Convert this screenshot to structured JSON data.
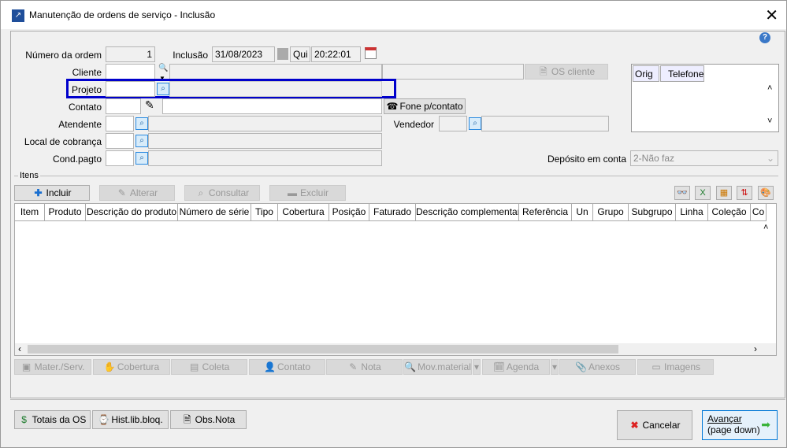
{
  "window": {
    "title": "Manutenção de ordens de serviço - Inclusão",
    "close": "✕"
  },
  "header": {
    "numero_label": "Número da ordem",
    "numero_value": "1",
    "inclusao_label": "Inclusão",
    "inclusao_date": "31/08/2023",
    "inclusao_day": "Qui",
    "inclusao_time": "20:22:01",
    "cliente_label": "Cliente",
    "projeto_label": "Projeto",
    "contato_label": "Contato",
    "atendente_label": "Atendente",
    "local_label": "Local de cobrança",
    "cond_label": "Cond.pagto",
    "vendedor_label": "Vendedor",
    "os_cliente": "OS cliente",
    "fone_contato": "Fone p/contato",
    "deposito_label": "Depósito em conta",
    "deposito_value": "2-Não faz",
    "phone_columns": [
      "Orig",
      "Telefone"
    ]
  },
  "itens": {
    "label": "Itens",
    "actions": [
      "Incluir",
      "Alterar",
      "Consultar",
      "Excluir"
    ],
    "columns": [
      "Item",
      "Produto",
      "Descrição do produto",
      "Número de série",
      "Tipo",
      "Cobertura",
      "Posição",
      "Faturado",
      "Descrição complementar",
      "Referência",
      "Un",
      "Grupo",
      "Subgrupo",
      "Linha",
      "Coleção",
      "Co"
    ],
    "tabs": [
      "Mater./Serv.",
      "Cobertura",
      "Coleta",
      "Contato",
      "Nota",
      "Mov.material",
      "Agenda",
      "Anexos",
      "Imagens"
    ]
  },
  "footer": {
    "totais": "Totais da OS",
    "hist": "Hist.lib.bloq.",
    "obs": "Obs.Nota",
    "cancelar": "Cancelar",
    "avancar": "Avançar",
    "avancar_sub": "(page down)"
  },
  "colors": {
    "highlight": "#0000cc",
    "accent": "#2a8ae0"
  }
}
